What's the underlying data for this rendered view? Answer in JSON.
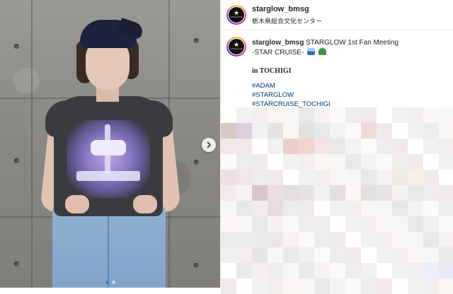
{
  "header": {
    "username": "starglow_bmsg",
    "location": "栃木県総合文化センター"
  },
  "caption": {
    "username": "starglow_bmsg",
    "line1_text": "STARGLOW 1st Fan Meeting",
    "line2_text": "-STAR CRUISE-",
    "emojis": [
      "ship-icon",
      "car-icon"
    ],
    "location_line": "in TOCHIGI",
    "hashtags": [
      "#ADAM",
      "#STARGLOW",
      "#STARCRUISE_TOCHIGI"
    ]
  },
  "avatar": {
    "logo_text": "★",
    "logo_small": "STARGLOW"
  },
  "carousel": {
    "dots_total": 2,
    "active_index": 0,
    "next_icon": "chevron-right-icon"
  },
  "colors": {
    "link": "#00376b",
    "active_dot": "#1e88e5",
    "text": "#262626"
  }
}
